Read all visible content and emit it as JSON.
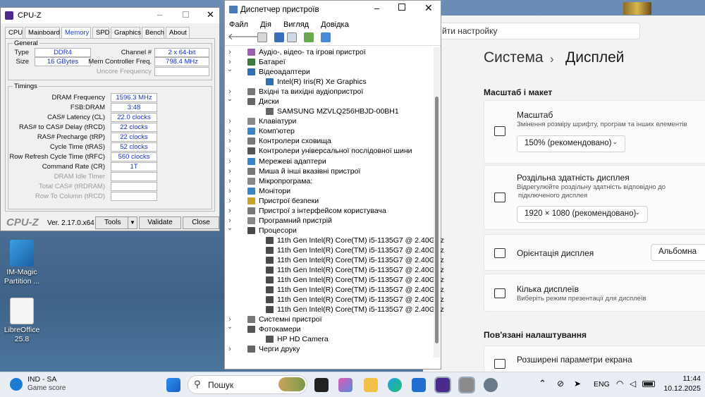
{
  "desktop": {
    "icons": [
      {
        "label1": "IM-Magic",
        "label2": "Partition ..."
      },
      {
        "label1": "LibreOffice",
        "label2": "25.8"
      }
    ]
  },
  "settings": {
    "search_placeholder": "йти настройку",
    "breadcrumb_parent": "Система",
    "breadcrumb_sep": "›",
    "breadcrumb_current": "Дисплей",
    "section_scale": "Масштаб і макет",
    "scale_title": "Масштаб",
    "scale_desc": "Змінення розміру шрифту, програм та інших елементів",
    "scale_value": "150% (рекомендовано)",
    "resolution_title": "Роздільна здатність дисплея",
    "resolution_desc1": "Відрегулюйте роздільну здатність відповідно до",
    "resolution_desc2": "підключеного дисплея",
    "resolution_value": "1920 × 1080 (рекомендовано)",
    "orientation_title": "Орієнтація дисплея",
    "orientation_value": "Альбомна",
    "multi_title": "Кілька дисплеїв",
    "multi_desc": "Виберіть режим презентації для дисплеїв",
    "section_related": "Пов'язані налаштування",
    "advanced_title": "Розширені параметри екрана"
  },
  "devmgr": {
    "title": "Диспетчер пристроїв",
    "menu": [
      "Файл",
      "Дія",
      "Вигляд",
      "Довідка"
    ],
    "tree": [
      {
        "level": 0,
        "exp": false,
        "icon": "#9a5fb0",
        "text": "Аудіо-, відео- та ігрові пристрої"
      },
      {
        "level": 0,
        "exp": false,
        "icon": "#3a7a3a",
        "text": "Батареї"
      },
      {
        "level": 0,
        "exp": true,
        "icon": "#2c6fb7",
        "text": "Відеоадаптери"
      },
      {
        "level": 1,
        "exp": null,
        "icon": "#2c6fb7",
        "text": "Intel(R) Iris(R) Xe Graphics"
      },
      {
        "level": 0,
        "exp": false,
        "icon": "#777777",
        "text": "Вхідні та вихідні аудіопристрої"
      },
      {
        "level": 0,
        "exp": true,
        "icon": "#666666",
        "text": "Диски"
      },
      {
        "level": 1,
        "exp": null,
        "icon": "#666666",
        "text": "SAMSUNG MZVLQ256HBJD-00BH1"
      },
      {
        "level": 0,
        "exp": false,
        "icon": "#888888",
        "text": "Клавіатури"
      },
      {
        "level": 0,
        "exp": false,
        "icon": "#3a85c8",
        "text": "Комп'ютер"
      },
      {
        "level": 0,
        "exp": false,
        "icon": "#777777",
        "text": "Контролери сховища"
      },
      {
        "level": 0,
        "exp": false,
        "icon": "#555555",
        "text": "Контролери універсальної послідовної шини"
      },
      {
        "level": 0,
        "exp": false,
        "icon": "#3a85c8",
        "text": "Мережеві адаптери"
      },
      {
        "level": 0,
        "exp": false,
        "icon": "#777777",
        "text": "Миша й інші вказівні пристрої"
      },
      {
        "level": 0,
        "exp": false,
        "icon": "#888888",
        "text": "Мікропрограма:"
      },
      {
        "level": 0,
        "exp": false,
        "icon": "#3a85c8",
        "text": "Монітори"
      },
      {
        "level": 0,
        "exp": false,
        "icon": "#c9a227",
        "text": "Пристрої безпеки"
      },
      {
        "level": 0,
        "exp": false,
        "icon": "#777777",
        "text": "Пристрої з інтерфейсом користувача"
      },
      {
        "level": 0,
        "exp": false,
        "icon": "#888888",
        "text": "Програмний пристрій"
      },
      {
        "level": 0,
        "exp": true,
        "icon": "#4a4a4a",
        "text": "Процесори"
      },
      {
        "level": 1,
        "exp": null,
        "icon": "#4a4a4a",
        "text": "11th Gen Intel(R) Core(TM) i5-1135G7 @ 2.40GHz"
      },
      {
        "level": 1,
        "exp": null,
        "icon": "#4a4a4a",
        "text": "11th Gen Intel(R) Core(TM) i5-1135G7 @ 2.40GHz"
      },
      {
        "level": 1,
        "exp": null,
        "icon": "#4a4a4a",
        "text": "11th Gen Intel(R) Core(TM) i5-1135G7 @ 2.40GHz"
      },
      {
        "level": 1,
        "exp": null,
        "icon": "#4a4a4a",
        "text": "11th Gen Intel(R) Core(TM) i5-1135G7 @ 2.40GHz"
      },
      {
        "level": 1,
        "exp": null,
        "icon": "#4a4a4a",
        "text": "11th Gen Intel(R) Core(TM) i5-1135G7 @ 2.40GHz"
      },
      {
        "level": 1,
        "exp": null,
        "icon": "#4a4a4a",
        "text": "11th Gen Intel(R) Core(TM) i5-1135G7 @ 2.40GHz"
      },
      {
        "level": 1,
        "exp": null,
        "icon": "#4a4a4a",
        "text": "11th Gen Intel(R) Core(TM) i5-1135G7 @ 2.40GHz"
      },
      {
        "level": 1,
        "exp": null,
        "icon": "#4a4a4a",
        "text": "11th Gen Intel(R) Core(TM) i5-1135G7 @ 2.40GHz"
      },
      {
        "level": 0,
        "exp": false,
        "icon": "#777777",
        "text": "Системні пристрої"
      },
      {
        "level": 0,
        "exp": true,
        "icon": "#555555",
        "text": "Фотокамери"
      },
      {
        "level": 1,
        "exp": null,
        "icon": "#555555",
        "text": "HP HD Camera"
      },
      {
        "level": 0,
        "exp": false,
        "icon": "#666666",
        "text": "Черги друку"
      }
    ]
  },
  "cpuz": {
    "title": "CPU-Z",
    "tabs": [
      "CPU",
      "Mainboard",
      "Memory",
      "SPD",
      "Graphics",
      "Bench",
      "About"
    ],
    "active_tab": "Memory",
    "general_label": "General",
    "type_label": "Type",
    "type_value": "DDR4",
    "size_label": "Size",
    "size_value": "16 GBytes",
    "channel_label": "Channel #",
    "channel_value": "2 x 64-bit",
    "mcf_label": "Mem Controller Freq.",
    "mcf_value": "798.4 MHz",
    "uncore_label": "Uncore Frequency",
    "timings_label": "Timings",
    "timings": [
      {
        "label": "DRAM Frequency",
        "value": "1596.3 MHz",
        "disabled": false
      },
      {
        "label": "FSB:DRAM",
        "value": "3:48",
        "disabled": false
      },
      {
        "label": "CAS# Latency (CL)",
        "value": "22.0 clocks",
        "disabled": false
      },
      {
        "label": "RAS# to CAS# Delay (tRCD)",
        "value": "22 clocks",
        "disabled": false
      },
      {
        "label": "RAS# Precharge (tRP)",
        "value": "22 clocks",
        "disabled": false
      },
      {
        "label": "Cycle Time (tRAS)",
        "value": "52 clocks",
        "disabled": false
      },
      {
        "label": "Row Refresh Cycle Time (tRFC)",
        "value": "560 clocks",
        "disabled": false
      },
      {
        "label": "Command Rate (CR)",
        "value": "1T",
        "disabled": false
      },
      {
        "label": "DRAM Idle Timer",
        "value": "",
        "disabled": true
      },
      {
        "label": "Total CAS# (tRDRAM)",
        "value": "",
        "disabled": true
      },
      {
        "label": "Row To Column (tRCD)",
        "value": "",
        "disabled": true
      }
    ],
    "brand": "CPU-Z",
    "version": "Ver. 2.17.0.x64",
    "tools_label": "Tools",
    "validate_label": "Validate",
    "close_label": "Close"
  },
  "taskbar": {
    "weather_title": "IND - SA",
    "weather_sub": "Game score",
    "search_label": "Пошук",
    "lang": "ENG",
    "time": "11:44",
    "date": "10.12.2025"
  }
}
